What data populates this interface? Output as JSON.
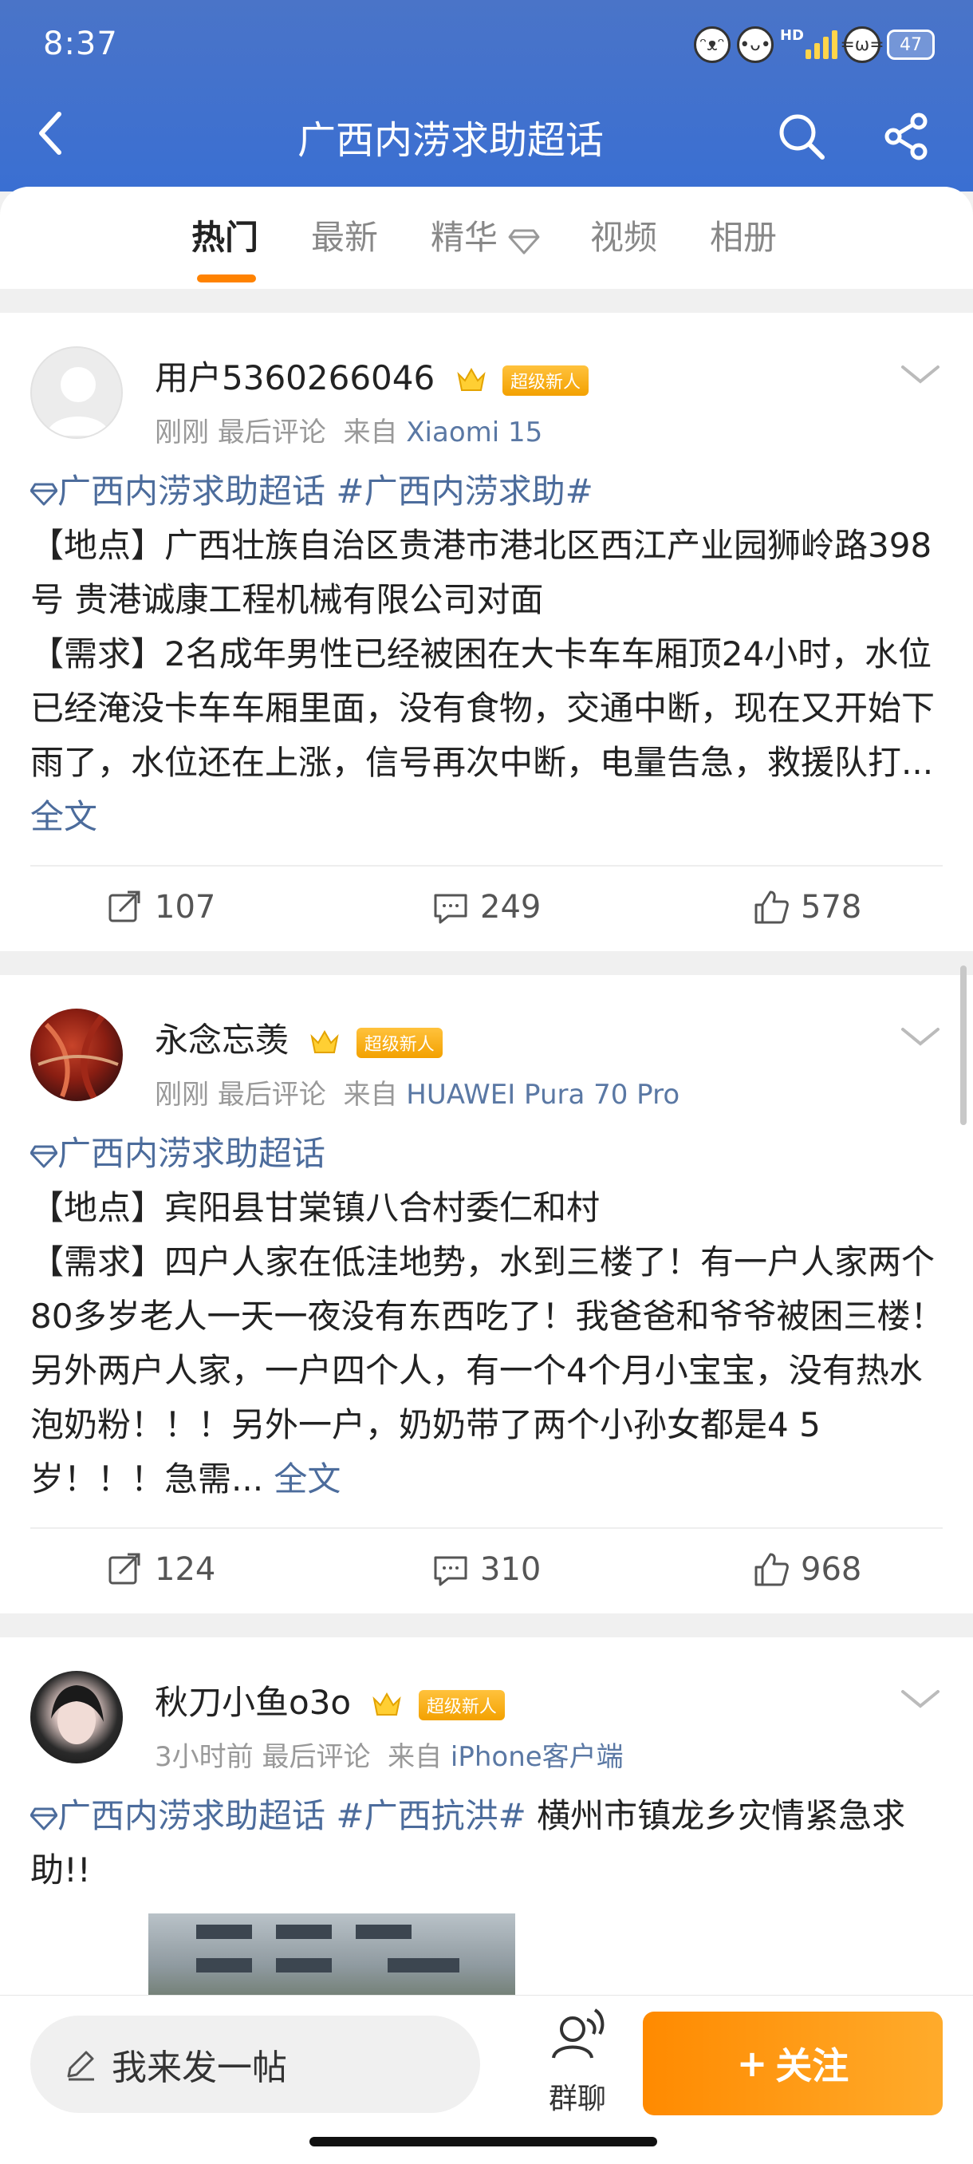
{
  "status_bar": {
    "time": "8:37",
    "hd": "HD",
    "battery": "47"
  },
  "header": {
    "title": "广西内涝求助超话"
  },
  "tabs": [
    {
      "label": "热门"
    },
    {
      "label": "最新"
    },
    {
      "label": "精华"
    },
    {
      "label": "视频"
    },
    {
      "label": "相册"
    }
  ],
  "posts": [
    {
      "username": "用户5360266046",
      "badge": "超级新人",
      "time": "刚刚",
      "last_comment": "最后评论",
      "from": "来自",
      "device": "Xiaomi 15",
      "topic1": "广西内涝求助超话",
      "topic2": "#广西内涝求助#",
      "body_after_topics": "",
      "line_location": "【地点】广西壮族自治区贵港市港北区西江产业园狮岭路398号  贵港诚康工程机械有限公司对面",
      "line_need": "【需求】2名成年男性已经被困在大卡车车厢顶24小时，水位已经淹没卡车车厢里面，没有食物，交通中断，现在又开始下雨了，水位还在上涨，信号再次中断，电量告急，救援队打...",
      "more": "全文",
      "reposts": "107",
      "comments": "249",
      "likes": "578"
    },
    {
      "username": "永念忘羡",
      "badge": "超级新人",
      "time": "刚刚",
      "last_comment": "最后评论",
      "from": "来自",
      "device": "HUAWEI Pura 70 Pro",
      "topic1": "广西内涝求助超话",
      "line_location": "【地点】宾阳县甘棠镇八合村委仁和村",
      "line_need": "【需求】四户人家在低洼地势，水到三楼了！有一户人家两个80多岁老人一天一夜没有东西吃了！我爸爸和爷爷被困三楼！另外两户人家，一户四个人，有一个4个月小宝宝，没有热水泡奶粉！！！另外一户，奶奶带了两个小孙女都是4 5岁！！！急需...",
      "more": "全文",
      "reposts": "124",
      "comments": "310",
      "likes": "968"
    },
    {
      "username": "秋刀小鱼o3o",
      "badge": "超级新人",
      "time": "3小时前",
      "last_comment": "最后评论",
      "from": "来自",
      "device": "iPhone客户端",
      "topic1": "广西内涝求助超话",
      "topic2": "#广西抗洪#",
      "body_text": " 横州市镇龙乡灾情紧急求助!!"
    }
  ],
  "bottom": {
    "compose_label": "我来发一帖",
    "group_chat_label": "群聊",
    "follow_label": "关注",
    "follow_plus": "+"
  }
}
